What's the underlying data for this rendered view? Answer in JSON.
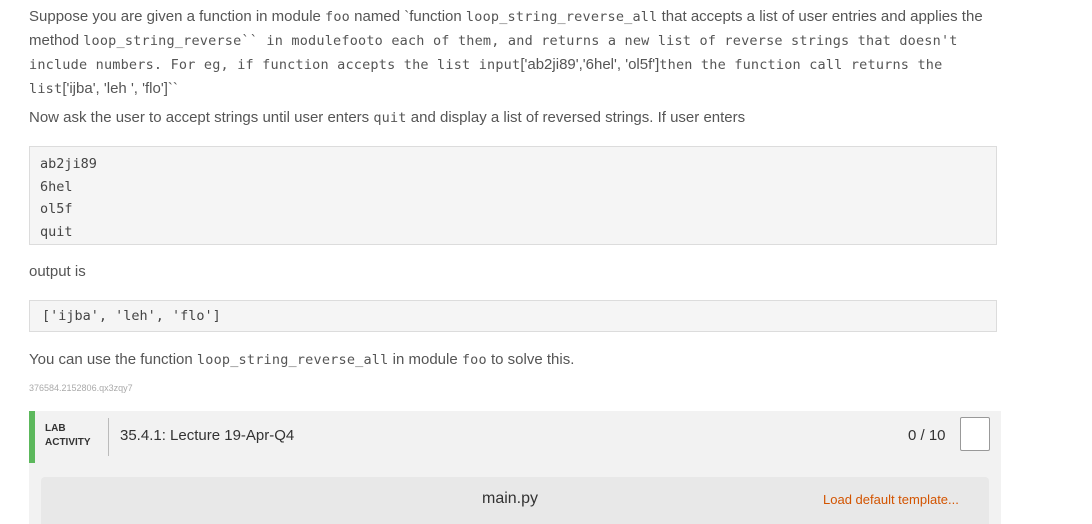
{
  "question": {
    "p1": {
      "t1": "Suppose you are given a function in module ",
      "c1": "foo",
      "t2": " named `function ",
      "c2": "loop_string_reverse_all",
      "t3": " that accepts a list of user entries and applies the method ",
      "c3": "loop_string_reverse`` in modulefooto each of them, and returns a new list of reverse strings that doesn't include numbers. For eg, if function accepts the list input",
      "t4": "['ab2ji89','6hel', 'ol5f']",
      "c4": "then the function call returns the list",
      "t5": "['ijba', 'leh ', 'flo']``"
    },
    "p2": {
      "t1": "Now ask the user to accept strings until user enters ",
      "c1": "quit",
      "t2": " and display a list of reversed strings. If user enters"
    },
    "input_lines": [
      "ab2ji89",
      "6hel",
      "ol5f",
      "quit"
    ],
    "output_label": "output is",
    "output_code": "['ijba', 'leh', 'flo']",
    "p4": {
      "t1": "You can use the function ",
      "c1": "loop_string_reverse_all",
      "t2": " in module ",
      "c2": "foo",
      "t3": " to solve this."
    },
    "token": "376584.2152806.qx3zqy7"
  },
  "lab": {
    "badge_line1": "LAB",
    "badge_line2": "ACTIVITY",
    "title": "35.4.1: Lecture 19-Apr-Q4",
    "score": "0 / 10",
    "file_name": "main.py",
    "load_template": "Load default template..."
  },
  "colors": {
    "accent": "#5cb85c",
    "link": "#d35400"
  }
}
